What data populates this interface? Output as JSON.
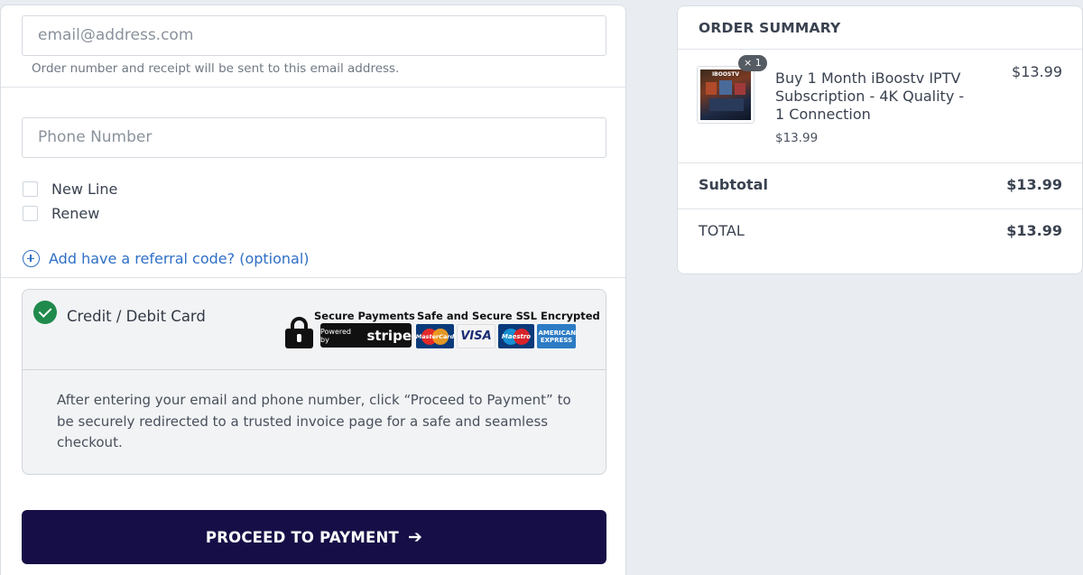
{
  "contact": {
    "email_placeholder": "email@address.com",
    "email_hint": "Order number and receipt will be sent to this email address.",
    "phone_placeholder": "Phone Number",
    "options": [
      {
        "label": "New Line",
        "checked": false
      },
      {
        "label": "Renew",
        "checked": false
      }
    ],
    "referral_link": "Add have a referral code? (optional)"
  },
  "payment": {
    "method_label": "Credit / Debit Card",
    "selected": true,
    "badge_secure_payments": "Secure Payments",
    "badge_ssl": "Safe and Secure SSL Encrypted",
    "stripe_powered_by": "Powered by",
    "stripe_name": "stripe",
    "card_brands": [
      "MasterCard",
      "VISA",
      "Maestro",
      "AMERICAN EXPRESS"
    ],
    "description": "After entering your email and phone number, click “Proceed to Payment” to be securely redirected to a trusted invoice page for a safe and seamless checkout.",
    "proceed_label": "PROCEED TO PAYMENT",
    "proceed_arrow": "➔"
  },
  "order_summary": {
    "title": "ORDER SUMMARY",
    "item": {
      "name": "Buy 1 Month iBoostv IPTV Subscription - 4K Quality - 1 Connection",
      "unit_price": "$13.99",
      "price": "$13.99",
      "quantity": "× 1",
      "thumb_logo": "IBOOSTV"
    },
    "subtotal_label": "Subtotal",
    "subtotal_value": "$13.99",
    "total_label": "TOTAL",
    "total_value": "$13.99"
  },
  "colors": {
    "primary_button": "#160f47",
    "link": "#2f6fc6",
    "check_green": "#1f8a4c"
  }
}
